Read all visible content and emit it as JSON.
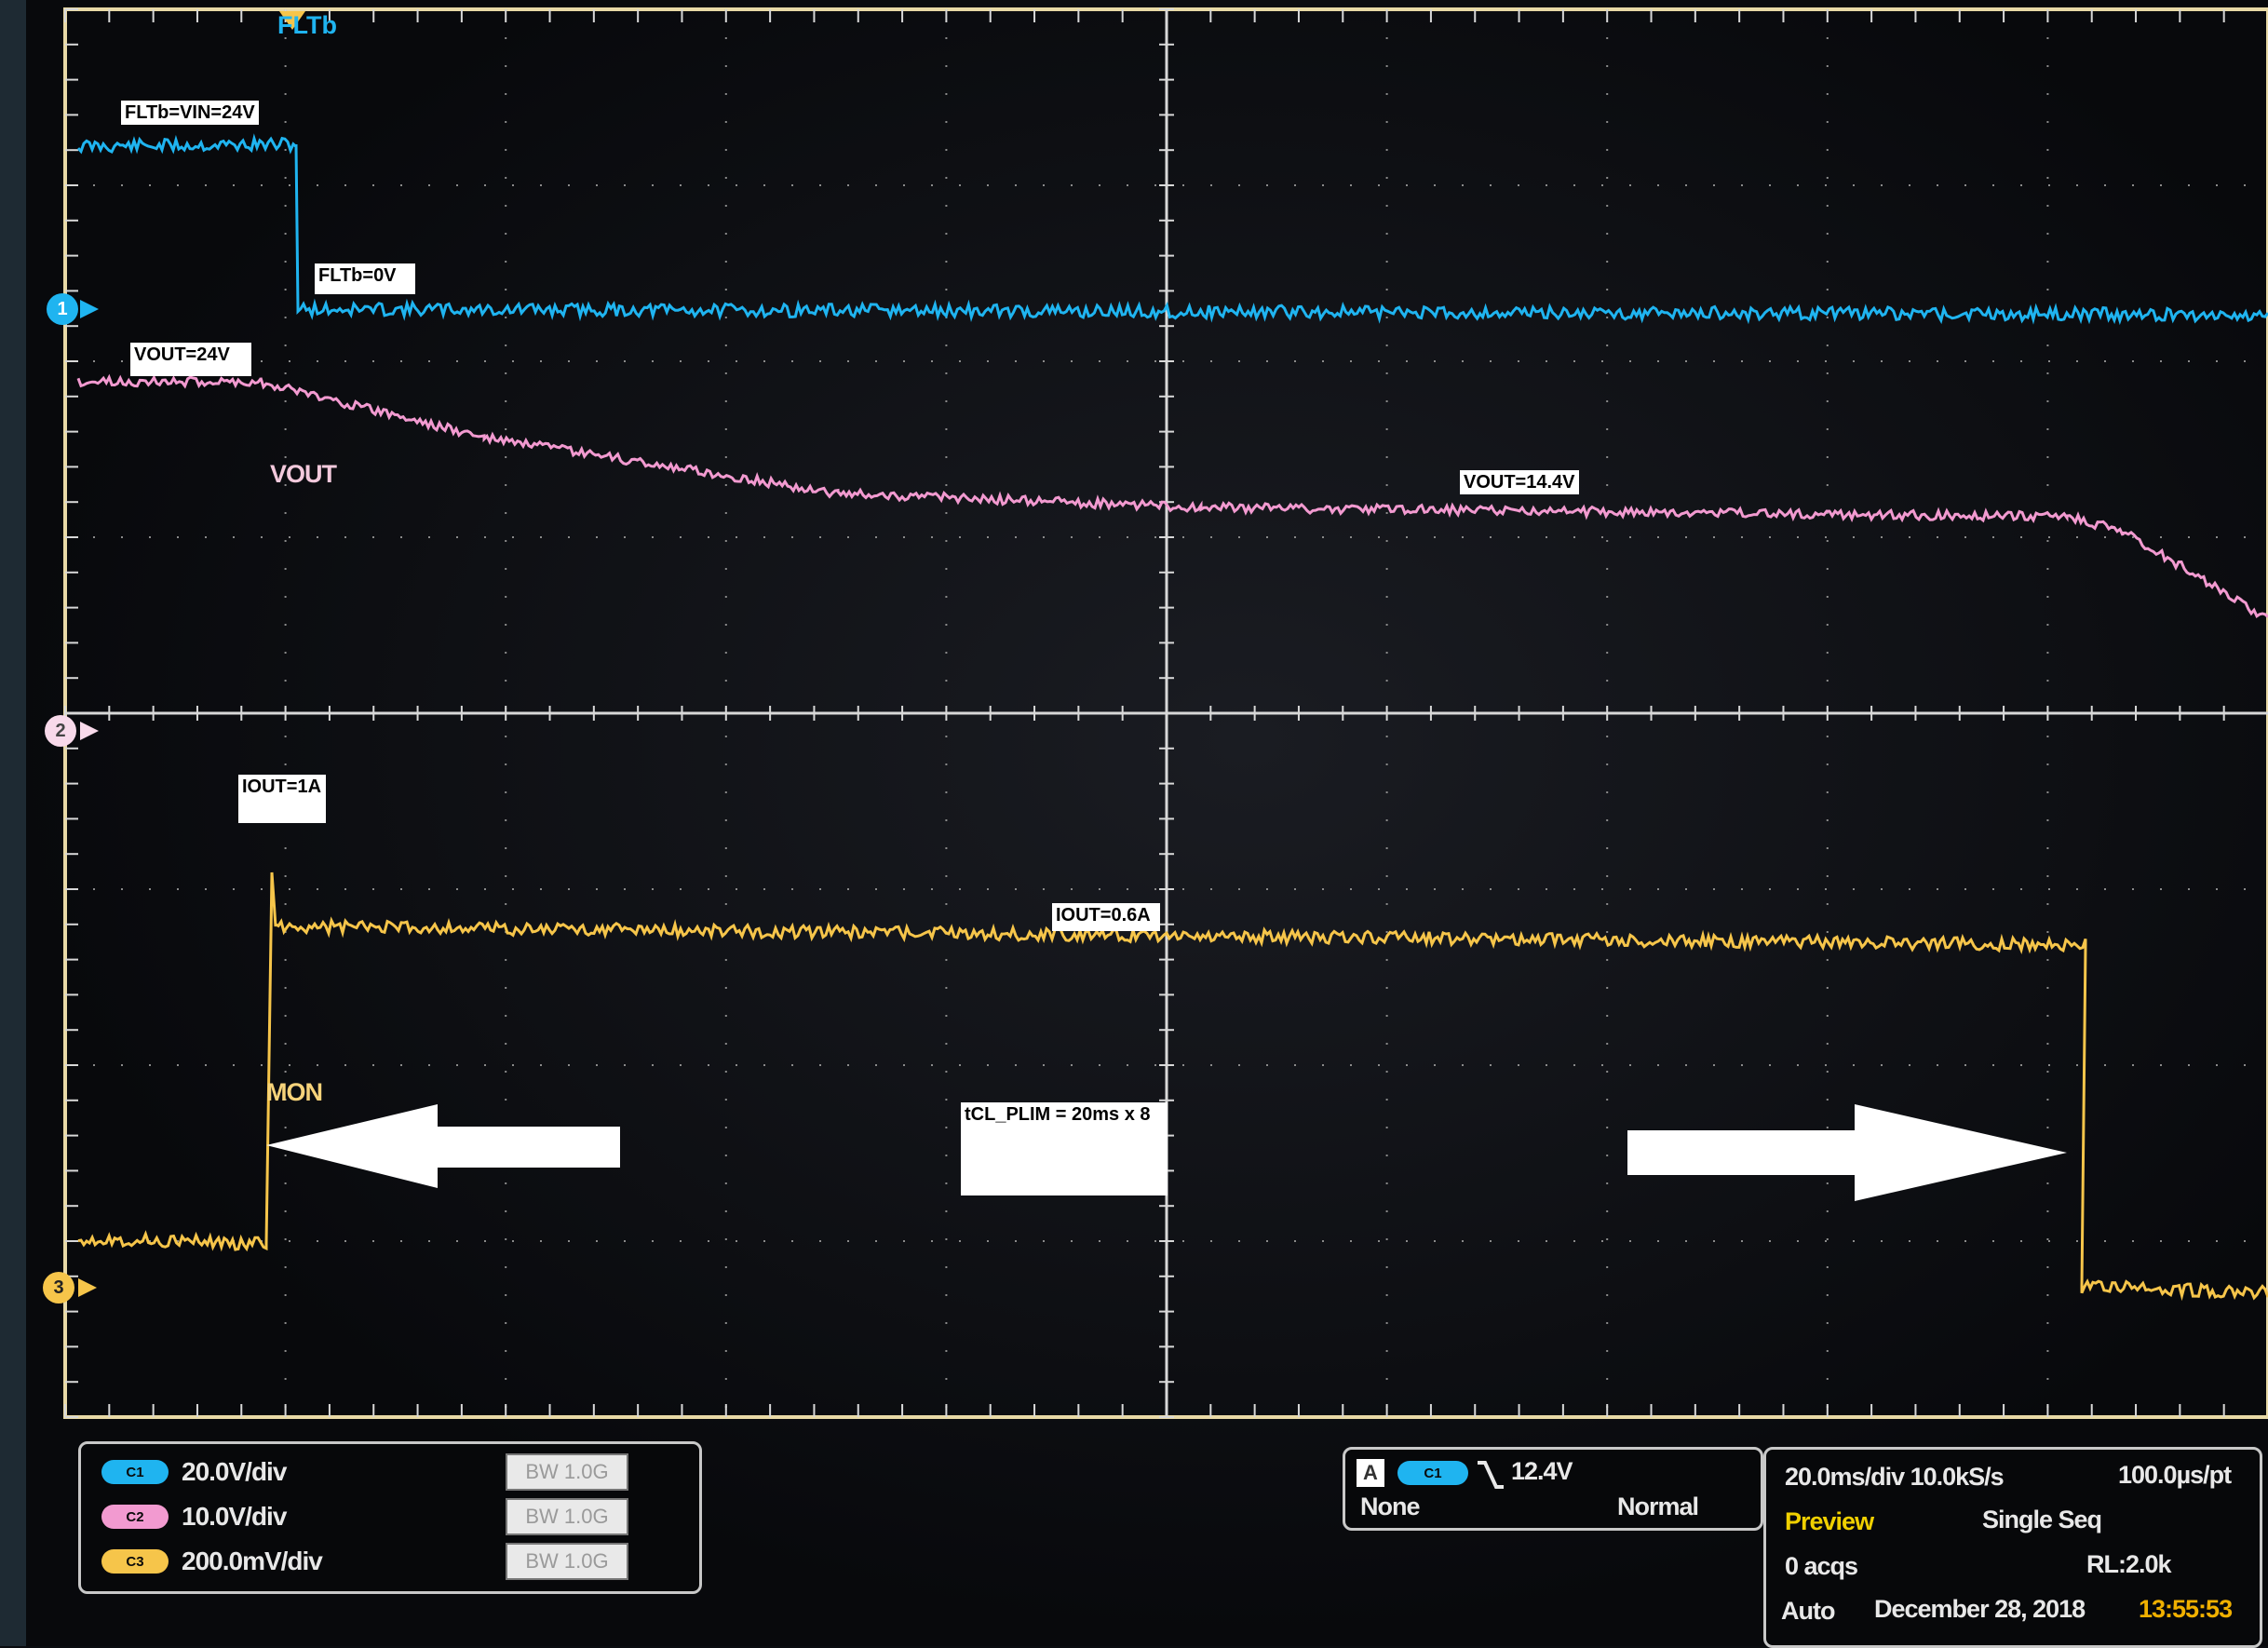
{
  "colors": {
    "ch1": "#1fb4f0",
    "ch2": "#f29ad0",
    "ch3": "#f6c54a",
    "grid": "#d8d8d8",
    "frame": "#e8d9a6",
    "preview": "#f0d000",
    "time": "#f0b000"
  },
  "trigger_marker_label": "FLTb",
  "annotations": {
    "fltb_high": "FLTb=VIN=24V",
    "fltb_low": "FLTb=0V",
    "vout_start": "VOUT=24V",
    "vout_mid": "VOUT=14.4V",
    "iout_peak": "IOUT=1A",
    "iout_limit": "IOUT=0.6A",
    "timer": "tCL_PLIM = 20ms x 8"
  },
  "trace_labels": {
    "vout": "VOUT",
    "mon": "MON"
  },
  "channel_markers": {
    "ch1": "1",
    "ch2": "2",
    "ch3": "3"
  },
  "channels": [
    {
      "tag": "C1",
      "scale": "20.0V/div",
      "bw": "BW 1.0G"
    },
    {
      "tag": "C2",
      "scale": "10.0V/div",
      "bw": "BW 1.0G"
    },
    {
      "tag": "C3",
      "scale": "200.0mV/div",
      "bw": "BW 1.0G"
    }
  ],
  "trigger": {
    "mode_letter": "A",
    "source": "C1",
    "slope_icon": "falling-edge-icon",
    "level": "12.4V",
    "coupling": "None",
    "type": "Normal"
  },
  "acquisition": {
    "timebase": "20.0ms/div 10.0kS/s",
    "resolution": "100.0µs/pt",
    "state": "Preview",
    "sequence": "Single Seq",
    "acqs": "0 acqs",
    "record_length": "RL:2.0k",
    "mode": "Auto",
    "date": "December 28, 2018",
    "time": "13:55:53"
  }
}
